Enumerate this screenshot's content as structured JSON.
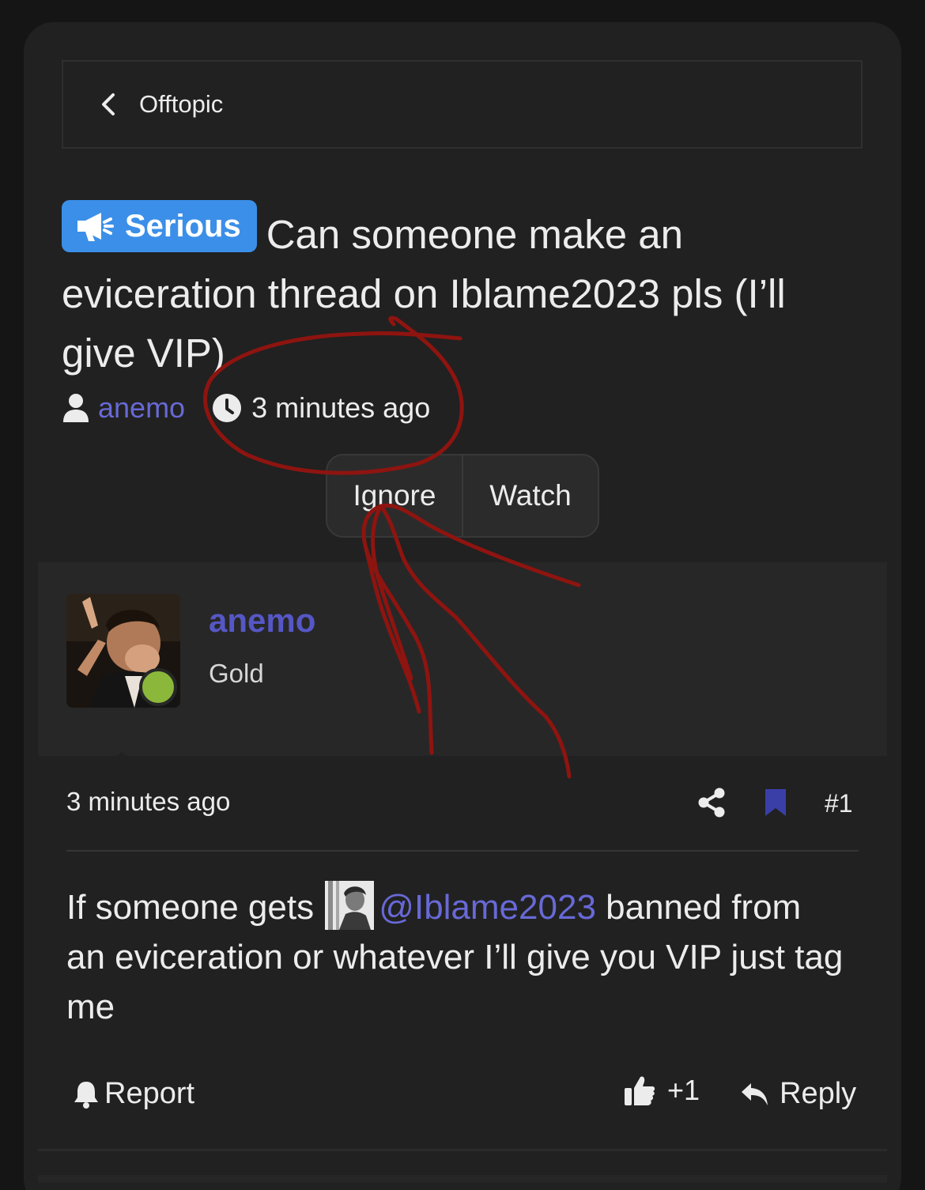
{
  "breadcrumb": {
    "label": "Offtopic"
  },
  "thread": {
    "prefix": "Serious",
    "title": "Can someone make an eviceration thread on Iblame2023 pls (I’ll give VIP)",
    "author": "anemo",
    "posted": "3 minutes ago"
  },
  "actions": {
    "ignore": "Ignore",
    "watch": "Watch"
  },
  "post": {
    "username": "anemo",
    "user_title": "Gold",
    "time": "3 minutes ago",
    "number": "#1",
    "body_before": "If someone gets ",
    "mention": "@Iblame2023",
    "body_after": " banned from an eviceration or whatever I’ll give you VIP just tag me",
    "report": "Report",
    "likes": "+1",
    "reply": "Reply"
  },
  "icons": {
    "back": "chevron-left-icon",
    "prefix": "megaphone-icon",
    "author": "user-icon",
    "time": "clock-icon",
    "share": "share-icon",
    "bookmark": "bookmark-icon",
    "report": "bell-icon",
    "like": "thumbs-up-icon",
    "reply": "reply-icon"
  },
  "colors": {
    "background": "#151515",
    "card": "#212121",
    "prefix_badge": "#3b8fe8",
    "link": "#6869d6",
    "username": "#5657c6",
    "online": "#8bb83a",
    "annotation": "#8e1410"
  }
}
